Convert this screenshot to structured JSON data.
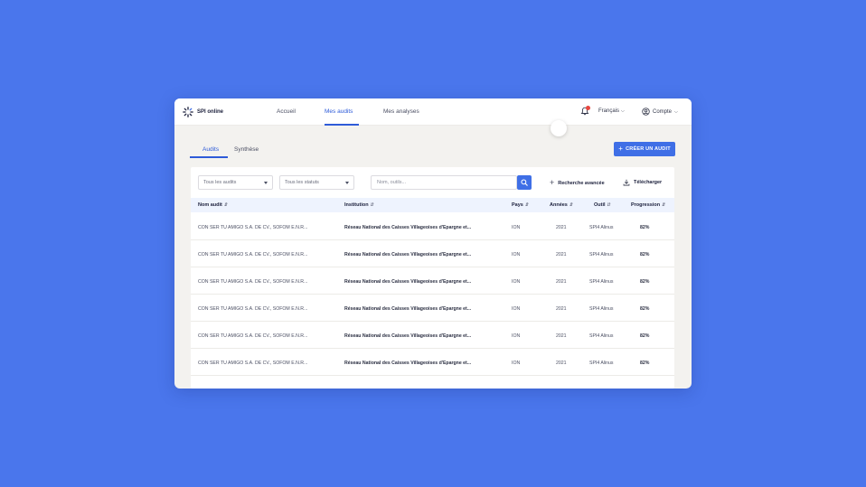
{
  "app": {
    "name": "SPI online"
  },
  "nav": [
    {
      "label": "Accueil"
    },
    {
      "label": "Mes audits"
    },
    {
      "label": "Mes analyses"
    }
  ],
  "header": {
    "language": "Français",
    "account": "Compte"
  },
  "tabs": [
    {
      "label": "Audits"
    },
    {
      "label": "Synthèse"
    }
  ],
  "create_button": "CRÉER UN AUDIT",
  "filters": {
    "audits_select": "Tous les audits",
    "status_select": "Tous les statuts",
    "search_placeholder": "Nom, outils..."
  },
  "actions": {
    "advanced_search": "Recherche avancée",
    "download": "Télécharger"
  },
  "table": {
    "columns": [
      "Nom audit",
      "Institution",
      "Pays",
      "Années",
      "Outil",
      "Progression"
    ],
    "rows": [
      [
        "CON SER TU AMIGO S.A. DE CV., SOFOM E.N.R...",
        "Réseau National des Caisses Villageoises d'Epargne et...",
        "ION",
        "2021",
        "SPI4 Alinus",
        "82%"
      ],
      [
        "CON SER TU AMIGO S.A. DE CV., SOFOM E.N.R...",
        "Réseau National des Caisses Villageoises d'Epargne et...",
        "ION",
        "2021",
        "SPI4 Alinus",
        "82%"
      ],
      [
        "CON SER TU AMIGO S.A. DE CV., SOFOM E.N.R...",
        "Réseau National des Caisses Villageoises d'Epargne et...",
        "ION",
        "2021",
        "SPI4 Alinus",
        "82%"
      ],
      [
        "CON SER TU AMIGO S.A. DE CV., SOFOM E.N.R...",
        "Réseau National des Caisses Villageoises d'Epargne et...",
        "ION",
        "2021",
        "SPI4 Alinus",
        "82%"
      ],
      [
        "CON SER TU AMIGO S.A. DE CV., SOFOM E.N.R...",
        "Réseau National des Caisses Villageoises d'Epargne et...",
        "ION",
        "2021",
        "SPI4 Alinus",
        "82%"
      ],
      [
        "CON SER TU AMIGO S.A. DE CV., SOFOM E.N.R...",
        "Réseau National des Caisses Villageoises d'Epargne et...",
        "ION",
        "2021",
        "SPI4 Alinus",
        "82%"
      ]
    ]
  },
  "icons": {
    "logo": "spinner-logo-icon",
    "bell": "bell-icon",
    "account": "user-circle-icon",
    "plus": "plus-icon",
    "search": "search-icon",
    "download": "download-icon"
  },
  "colors": {
    "background": "#4a76ec",
    "accent": "#3f6fe6",
    "notification": "#e8473f",
    "table_header": "#eef3fe"
  }
}
